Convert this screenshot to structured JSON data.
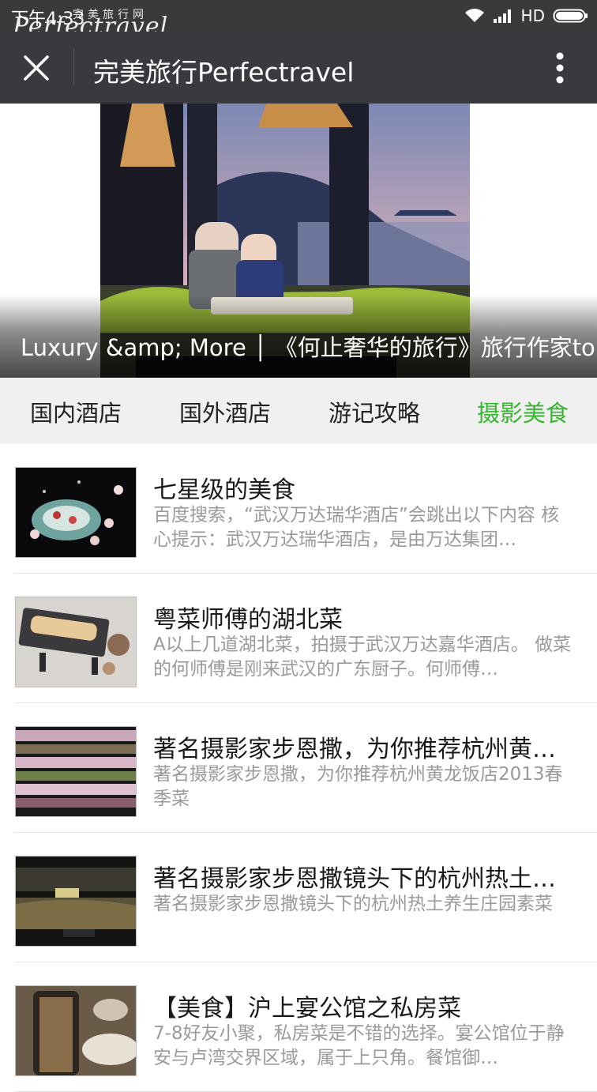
{
  "status_bar": {
    "time": "下午4:33",
    "network": "HD",
    "watermark_cn": "完美旅行网",
    "watermark_en": "Perfectravel"
  },
  "title_bar": {
    "title": "完美旅行Perfectravel",
    "close_icon": "close-icon",
    "more_icon": "more-vertical-icon"
  },
  "banner": {
    "caption": "Luxury &amp; More │ 《何止奢华的旅行》旅行作家to...."
  },
  "tabs": {
    "items": [
      "国内酒店",
      "国外酒店",
      "游记攻略",
      "摄影美食"
    ],
    "active_index": 3,
    "active_color": "#36b62e"
  },
  "articles": [
    {
      "title": "七星级的美食",
      "desc": "百度搜索，“武汉万达瑞华酒店”会跳出以下内容 核心提示：武汉万达瑞华酒店，是由万达集团…"
    },
    {
      "title": "粤菜师傅的湖北菜",
      "desc": "A以上几道湖北菜，拍摄于武汉万达嘉华酒店。 做菜的何师傅是刚来武汉的广东厨子。何师傅…"
    },
    {
      "title": "著名摄影家步恩撒，为你推荐杭州黄…",
      "desc": "著名摄影家步恩撒，为你推荐杭州黄龙饭店2013春季菜"
    },
    {
      "title": "著名摄影家步恩撒镜头下的杭州热土…",
      "desc": "著名摄影家步恩撒镜头下的杭州热土养生庄园素菜"
    },
    {
      "title": "【美食】沪上宴公馆之私房菜",
      "desc": "7-8好友小聚，私房菜是不错的选择。宴公馆位于静安与卢湾交界区域，属于上只角。餐馆御…"
    }
  ]
}
